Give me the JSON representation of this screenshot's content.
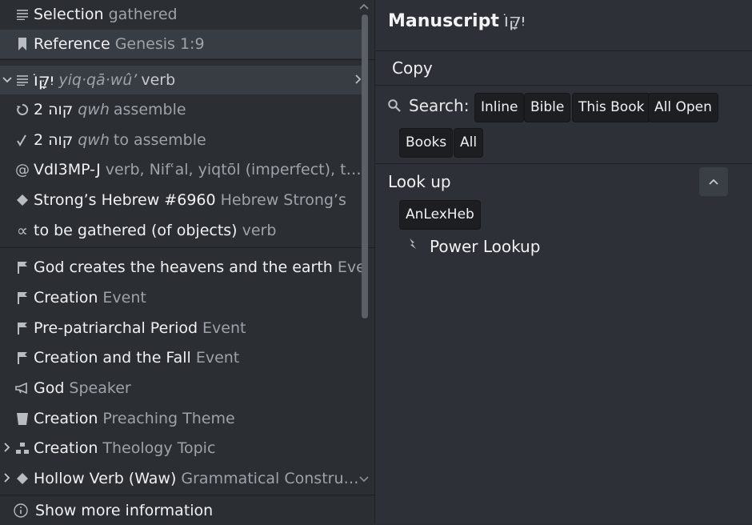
{
  "left": {
    "rows": [
      {
        "label": "Selection",
        "sub": "gathered"
      },
      {
        "label": "Reference",
        "sub": "Genesis 1:9"
      },
      {
        "label": "יִקָּוֹ",
        "sub_italic": "yiq·qā·wû’",
        "sub": "verb"
      },
      {
        "label": "2 קוה",
        "sub_italic": "qwh",
        "sub": "assemble"
      },
      {
        "label": "2 קוה",
        "sub_italic": "qwh",
        "sub": "to assemble"
      },
      {
        "label": "VdI3MP-J",
        "sub": "verb, Nifʿal, yiqtōl (imperfect), thir…"
      },
      {
        "label": "Strong’s Hebrew #6960",
        "sub": "Hebrew Strong’s"
      },
      {
        "label": "to be gathered (of objects)",
        "sub": "verb"
      },
      {
        "label": "God creates the heavens and the earth",
        "sub": "Event"
      },
      {
        "label": "Creation",
        "sub": "Event"
      },
      {
        "label": "Pre-patriarchal Period",
        "sub": "Event"
      },
      {
        "label": "Creation and the Fall",
        "sub": "Event"
      },
      {
        "label": "God",
        "sub": "Speaker"
      },
      {
        "label": "Creation",
        "sub": "Preaching Theme"
      },
      {
        "label": "Creation",
        "sub": "Theology Topic"
      },
      {
        "label": "Hollow Verb (Waw)",
        "sub": "Grammatical Constructi…"
      }
    ],
    "footer": "Show more information"
  },
  "right": {
    "title": "Manuscript",
    "title_hebrew": "יִקָּוֹ",
    "copy": "Copy",
    "search_label": "Search:",
    "search_chips": [
      "Inline",
      "Bible",
      "This Book",
      "All Open",
      "Books",
      "All"
    ],
    "lookup_label": "Look up",
    "lookup_chip": "AnLexHeb",
    "power_lookup": "Power Lookup"
  },
  "icons": {
    "selection": "list-icon",
    "reference": "bookmark-icon",
    "lemma": "list-icon",
    "root": "cycle-icon",
    "root2": "root-icon",
    "morph": "at-icon",
    "strongs": "diamond-icon",
    "sense": "alpha-icon",
    "event": "flag-icon",
    "speaker": "megaphone-icon",
    "theme": "pulpit-icon",
    "topic": "hierarchy-icon",
    "construction": "diamond-icon",
    "info": "info-icon",
    "search": "search-icon",
    "power": "lightning-icon"
  },
  "colors": {
    "background": "#2b2e33",
    "highlight_row": "#383c43",
    "chip_bg": "#1c1e22",
    "muted_text": "#9ea3aa"
  }
}
